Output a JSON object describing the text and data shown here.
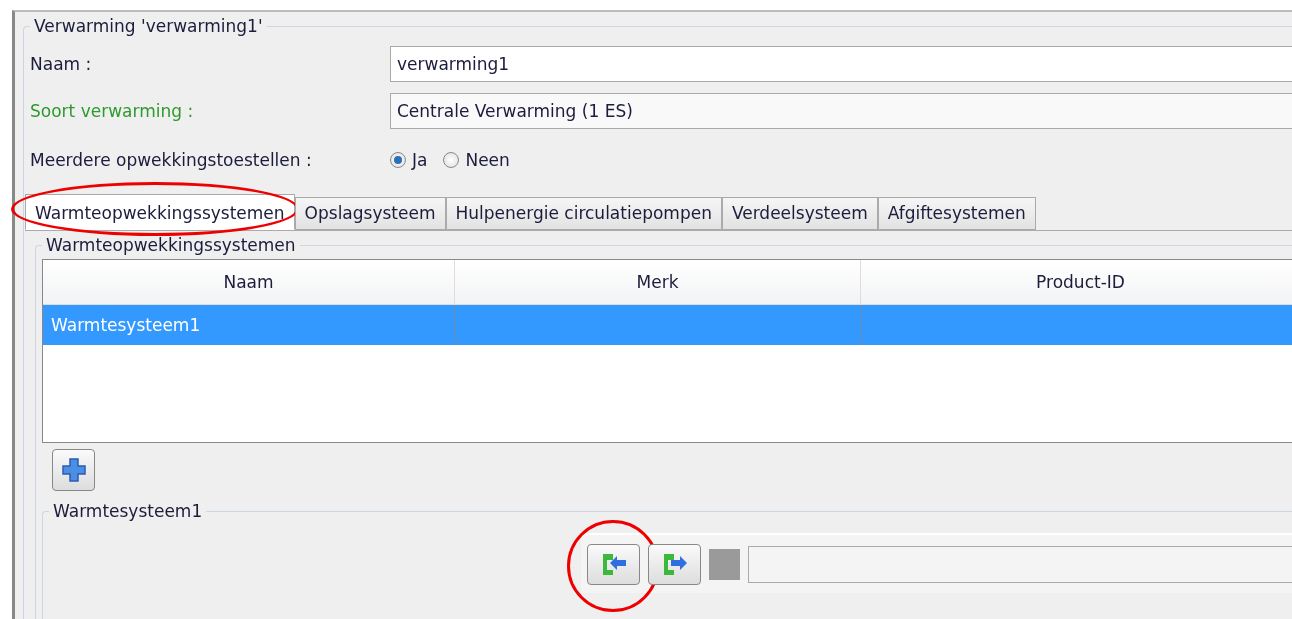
{
  "group_title": "Verwarming 'verwarming1'",
  "fields": [
    {
      "label": "Naam :",
      "value": "verwarming1",
      "kind": "input",
      "color": "#1c1c3c"
    },
    {
      "label": "Soort verwarming :",
      "value": "Centrale Verwarming (1 ES)",
      "kind": "combo",
      "color": "#2e9a2e"
    }
  ],
  "radio_group": {
    "label": "Meerdere opwekkingstoestellen :",
    "options": [
      {
        "label": "Ja",
        "selected": true
      },
      {
        "label": "Neen",
        "selected": false
      }
    ]
  },
  "tabs": [
    {
      "label": "Warmteopwekkingssystemen",
      "selected": true,
      "circled": true
    },
    {
      "label": "Opslagsysteem",
      "selected": false,
      "circled": false
    },
    {
      "label": "Hulpenergie circulatiepompen",
      "selected": false,
      "circled": false
    },
    {
      "label": "Verdeelsysteem",
      "selected": false,
      "circled": false
    },
    {
      "label": "Afgiftesystemen",
      "selected": false,
      "circled": false
    }
  ],
  "systems_group": {
    "title": "Warmteopwekkingssystemen",
    "table": {
      "columns": [
        "Naam",
        "Merk",
        "Product-ID"
      ],
      "rows": [
        {
          "cells": [
            "Warmtesysteem1"
          ],
          "selected": true
        }
      ]
    }
  },
  "detail_group": {
    "title": "Warmtesysteem1",
    "toolbar_buttons": [
      {
        "kind": "import",
        "disabled": false,
        "circled": true
      },
      {
        "kind": "export",
        "disabled": false,
        "circled": false
      },
      {
        "kind": "blank",
        "disabled": true,
        "circled": false
      }
    ]
  }
}
